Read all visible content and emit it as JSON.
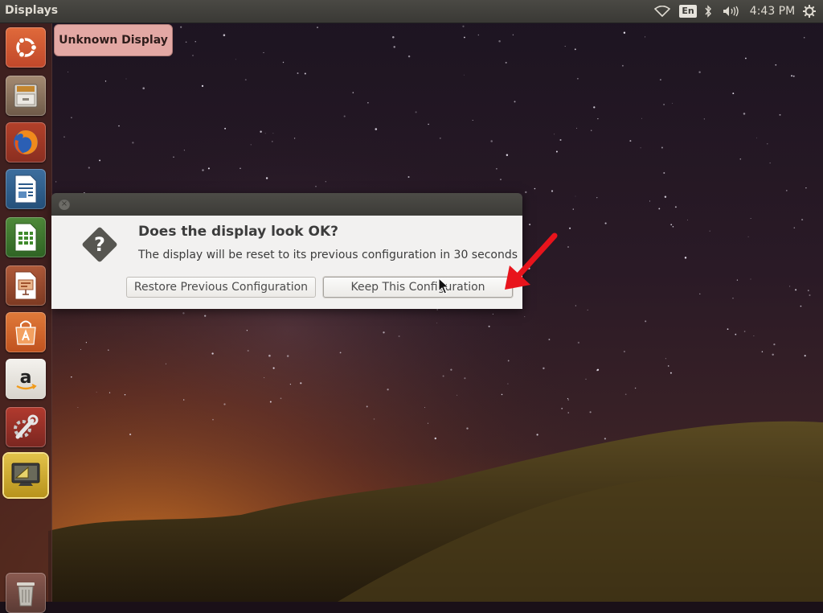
{
  "top_panel": {
    "title": "Displays",
    "keyboard_layout": "En",
    "clock": "4:43 PM",
    "tray_icons": [
      "wifi-icon",
      "bluetooth-icon",
      "volume-icon",
      "system-gear-icon"
    ]
  },
  "launcher": {
    "items": [
      {
        "name": "dash-home",
        "icon": "ubuntu-logo-icon"
      },
      {
        "name": "files",
        "icon": "file-cabinet-icon"
      },
      {
        "name": "firefox",
        "icon": "firefox-icon"
      },
      {
        "name": "libreoffice-writer",
        "icon": "writer-icon"
      },
      {
        "name": "libreoffice-calc",
        "icon": "calc-icon"
      },
      {
        "name": "libreoffice-impress",
        "icon": "impress-icon"
      },
      {
        "name": "software-center",
        "icon": "shopping-bag-icon"
      },
      {
        "name": "amazon",
        "icon": "amazon-icon"
      },
      {
        "name": "system-settings",
        "icon": "wrench-icon"
      },
      {
        "name": "displays",
        "icon": "display-settings-icon"
      },
      {
        "name": "trash",
        "icon": "trash-icon"
      }
    ],
    "accent": "#46221e"
  },
  "app_badge": {
    "label": "Unknown Display",
    "color": "#e3a8a4"
  },
  "dialog": {
    "heading": "Does the display look OK?",
    "message": "The display will be reset to its previous configuration in 30 seconds",
    "restore_label": "Restore Previous Configuration",
    "keep_label": "Keep This Configuration",
    "icon": "question-icon"
  },
  "annotation": {
    "arrow_color": "#e8141c"
  }
}
